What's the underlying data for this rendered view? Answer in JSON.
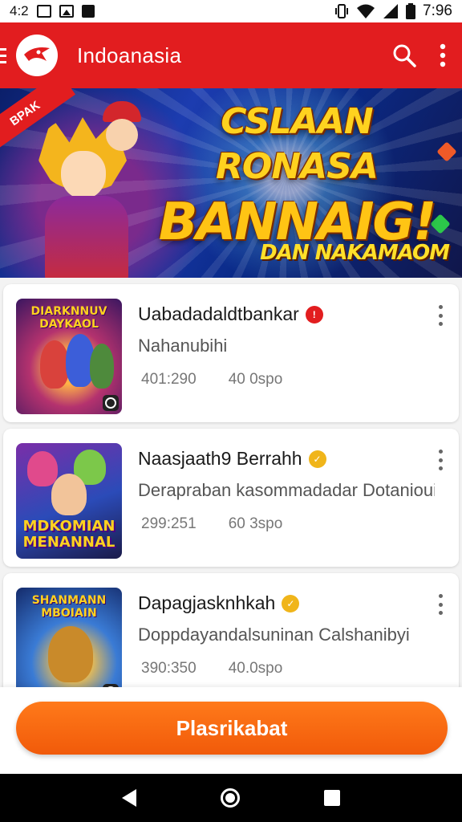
{
  "status_bar": {
    "left_text": "4:2",
    "time": "7:96",
    "icons": [
      "gallery-icon",
      "image-icon",
      "shopping-bag-icon",
      "vibrate-icon",
      "wifi-icon",
      "signal-icon",
      "battery-icon"
    ]
  },
  "app_bar": {
    "title": "Indoanasia",
    "icons": [
      "menu-icon",
      "app-logo-icon",
      "search-icon",
      "more-vert-icon"
    ],
    "background": "#e21d1f"
  },
  "banner": {
    "ribbon": "BPAK",
    "line1": "CSLAAN RONASA",
    "line2": "BANNAIG!",
    "subline": "DAN NAKAMAOM"
  },
  "items": [
    {
      "title": "Uabadadaldtbankar",
      "subtitle": "Nahanubihi",
      "meta_left": "401:290",
      "meta_right": "40 0spo",
      "badge_color": "#e21d1f",
      "thumb_label": "DIARKNNUV DAYKAOL"
    },
    {
      "title": "Naasjaath9 Berrahh",
      "subtitle": "Derapraban kasommadadar Dotanioui",
      "meta_left": "299:251",
      "meta_right": "60 3spo",
      "badge_color": "#f0b51a",
      "thumb_label": "MDKOMIAN MENANNAL"
    },
    {
      "title": "Dapagjasknhkah",
      "subtitle": "Doppdayandalsuninan Calshanibyi",
      "meta_left": "390:350",
      "meta_right": "40.0spo",
      "badge_color": "#f0b51a",
      "thumb_label": "SHANMANN MBOIAIN"
    }
  ],
  "cta": {
    "label": "Plasrikabat",
    "color": "#f36a10"
  },
  "nav_bar": {
    "icons": [
      "back-icon",
      "home-icon",
      "recents-icon"
    ]
  }
}
